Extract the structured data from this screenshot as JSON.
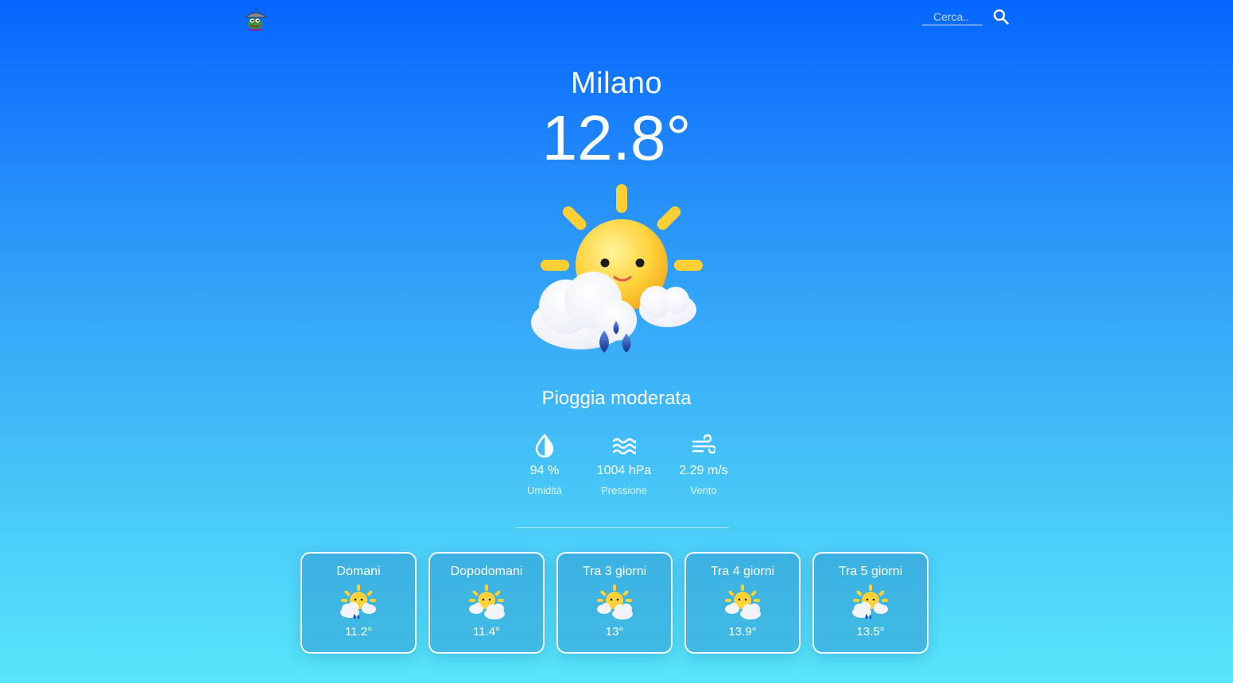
{
  "header": {
    "logo_icon": "umbrella-frog-logo-icon",
    "search": {
      "placeholder": "Cerca..",
      "value": "",
      "button_icon": "search-icon"
    }
  },
  "current": {
    "city": "Milano",
    "temperature": "12.8°",
    "condition_icon": "sun-cloud-rain-icon",
    "description": "Pioggia moderata",
    "stats": [
      {
        "icon": "humidity-drop-icon",
        "value": "94 %",
        "label": "Umidità"
      },
      {
        "icon": "pressure-waves-icon",
        "value": "1004 hPa",
        "label": "Pressione"
      },
      {
        "icon": "wind-icon",
        "value": "2.29 m/s",
        "label": "Vento"
      }
    ]
  },
  "forecast": [
    {
      "day": "Domani",
      "icon": "sun-cloud-rain-icon",
      "temp": "11.2°"
    },
    {
      "day": "Dopodomani",
      "icon": "sun-cloud-icon",
      "temp": "11.4°"
    },
    {
      "day": "Tra 3 giorni",
      "icon": "sun-cloud-icon",
      "temp": "13°"
    },
    {
      "day": "Tra 4 giorni",
      "icon": "sun-cloud-icon",
      "temp": "13.9°"
    },
    {
      "day": "Tra 5 giorni",
      "icon": "sun-cloud-rain-icon",
      "temp": "13.5°"
    }
  ],
  "colors": {
    "bg_top": "#0565ff",
    "bg_bottom": "#57e6fb",
    "sun": "#ffd23a",
    "cloud": "#f4f6fb",
    "rain": "#1b4fb4"
  }
}
